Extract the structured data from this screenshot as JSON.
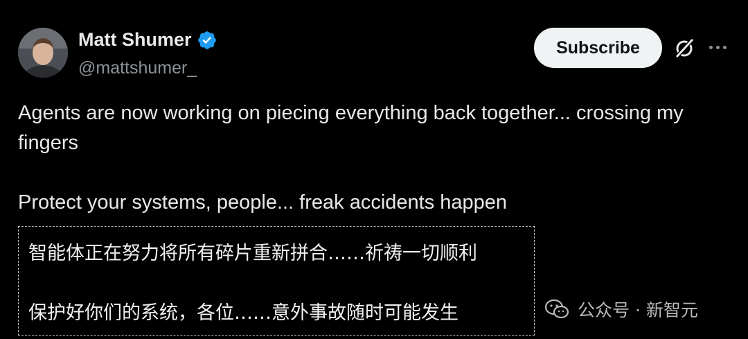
{
  "author": {
    "name": "Matt Shumer",
    "handle": "@mattshumer_",
    "verified_icon": "verified-badge-icon",
    "verified_color": "#1d9bf0"
  },
  "actions": {
    "subscribe_label": "Subscribe",
    "grok_icon": "grok-icon",
    "more_icon": "more-icon"
  },
  "tweet": {
    "line1": "Agents are now working on piecing everything back together... crossing my fingers",
    "line2": "Protect your systems, people... freak accidents happen"
  },
  "translation": {
    "line1": "智能体正在努力将所有碎片重新拼合……祈祷一切顺利",
    "line2": "保护好你们的系统，各位……意外事故随时可能发生"
  },
  "watermark": {
    "text": "公众号 · 新智元",
    "icon": "wechat-icon"
  },
  "colors": {
    "background": "#000000",
    "text": "#e7e9ea",
    "secondary": "#8b9298",
    "button_bg": "#eff3f4"
  }
}
